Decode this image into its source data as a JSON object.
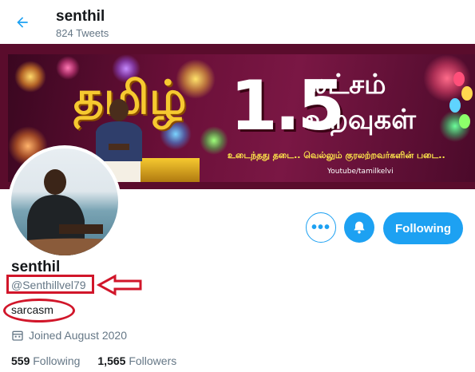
{
  "header": {
    "back_icon": "arrow-left-icon",
    "name": "senthil",
    "tweet_count": "824 Tweets"
  },
  "banner": {
    "number": "1.5",
    "line1": "லட்சம்",
    "line2": "உறவுகள்",
    "subtitle": "உடைந்தது தடை.. வெல்லும் குரலற்றவர்களின் படை..",
    "channel": "Youtube/tamilkelvi",
    "tamil_logo": "தமிழ்"
  },
  "actions": {
    "more_icon": "more-dots-icon",
    "bell_icon": "bell-notify-icon",
    "following_label": "Following"
  },
  "profile": {
    "name": "senthil",
    "handle": "@Senthillvel79",
    "bio": "sarcasm",
    "joined_icon": "calendar-icon",
    "joined": "Joined August 2020",
    "following_count": "559",
    "following_label": "Following",
    "followers_count": "1,565",
    "followers_label": "Followers"
  },
  "colors": {
    "accent": "#1da1f2",
    "annotation": "#d1162a",
    "muted": "#657786"
  }
}
